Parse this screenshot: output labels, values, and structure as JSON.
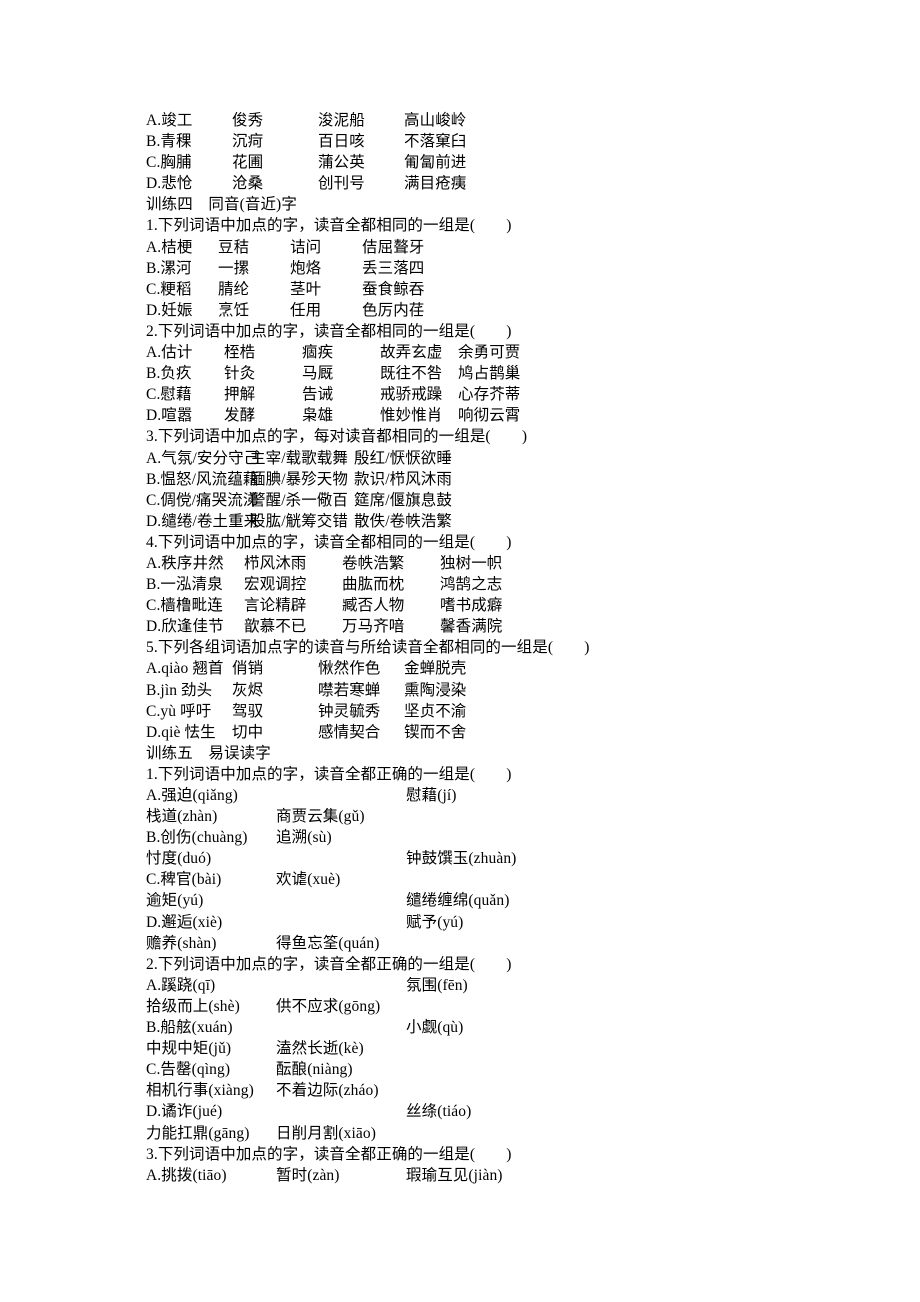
{
  "document": {
    "blocks": [
      {
        "kind": "option",
        "cols": "w-a",
        "lead": "A.竣工",
        "items": [
          "俊秀",
          "浚泥船",
          "高山峻岭"
        ]
      },
      {
        "kind": "option",
        "cols": "w-a",
        "lead": "B.青稞",
        "items": [
          "沉疴",
          "百日咳",
          "不落窠臼"
        ]
      },
      {
        "kind": "option",
        "cols": "w-a",
        "lead": "C.胸脯",
        "items": [
          "花圃",
          "蒲公英",
          "匍匐前进"
        ]
      },
      {
        "kind": "option",
        "cols": "w-a",
        "lead": "D.悲怆",
        "items": [
          "沧桑",
          "创刊号",
          "满目疮痍"
        ]
      },
      {
        "kind": "section",
        "text": "训练四　同音(音近)字"
      },
      {
        "kind": "question",
        "text": "1.下列词语中加点的字，读音全都相同的一组是(　　)"
      },
      {
        "kind": "option",
        "cols": "w-b",
        "lead": "A.桔梗",
        "items": [
          "豆秸",
          "诘问",
          "佶屈聱牙"
        ]
      },
      {
        "kind": "option",
        "cols": "w-b",
        "lead": "B.漯河",
        "items": [
          "一摞",
          "炮烙",
          "丢三落四"
        ]
      },
      {
        "kind": "option",
        "cols": "w-b",
        "lead": "C.粳稻",
        "items": [
          "腈纶",
          "茎叶",
          "蚕食鲸吞"
        ]
      },
      {
        "kind": "option",
        "cols": "w-b",
        "lead": "D.妊娠",
        "items": [
          "烹饪",
          "任用",
          "色厉内荏"
        ]
      },
      {
        "kind": "question",
        "text": "2.下列词语中加点的字，读音全都相同的一组是(　　)"
      },
      {
        "kind": "option",
        "cols": "w-c",
        "lead": "A.估计",
        "items": [
          "桎梏",
          "痼疾",
          "故弄玄虚",
          "余勇可贾"
        ]
      },
      {
        "kind": "option",
        "cols": "w-c",
        "lead": "B.负疚",
        "items": [
          "针灸",
          "马厩",
          "既往不咎",
          "鸠占鹊巢"
        ]
      },
      {
        "kind": "option",
        "cols": "w-c",
        "lead": "C.慰藉",
        "items": [
          "押解",
          "告诫",
          "戒骄戒躁",
          "心存芥蒂"
        ]
      },
      {
        "kind": "option",
        "cols": "w-c",
        "lead": "D.喧嚣",
        "items": [
          "发酵",
          "枭雄",
          "惟妙惟肖",
          "响彻云霄"
        ]
      },
      {
        "kind": "question",
        "text": "3.下列词语中加点的字，每对读音都相同的一组是(　　)"
      },
      {
        "kind": "option",
        "cols": "w-d",
        "lead": "A.气氛/安分守己",
        "items": [
          "主宰/载歌载舞",
          "殷红/恹恹欲睡"
        ]
      },
      {
        "kind": "option",
        "cols": "w-d",
        "lead": "B.愠怒/风流蕴藉",
        "items": [
          "腼腆/暴殄天物",
          "款识/栉风沐雨"
        ]
      },
      {
        "kind": "option",
        "cols": "w-d",
        "lead": "C.倜傥/痛哭流涕",
        "items": [
          "警醒/杀一儆百",
          "筵席/偃旗息鼓"
        ]
      },
      {
        "kind": "option",
        "cols": "w-d",
        "lead": "D.缱绻/卷土重来",
        "items": [
          "股肱/觥筹交错",
          "散佚/卷帙浩繁"
        ]
      },
      {
        "kind": "question",
        "text": "4.下列词语中加点的字，读音全都相同的一组是(　　)"
      },
      {
        "kind": "option",
        "cols": "w-e",
        "lead": "A.秩序井然",
        "items": [
          "栉风沐雨",
          "卷帙浩繁",
          "独树一帜"
        ]
      },
      {
        "kind": "option",
        "cols": "w-e",
        "lead": "B.一泓清泉",
        "items": [
          "宏观调控",
          "曲肱而枕",
          "鸿鹄之志"
        ]
      },
      {
        "kind": "option",
        "cols": "w-e",
        "lead": "C.樯橹毗连",
        "items": [
          "言论精辟",
          "臧否人物",
          "嗜书成癖"
        ]
      },
      {
        "kind": "option",
        "cols": "w-e",
        "lead": "D.欣逢佳节",
        "items": [
          "歆慕不已",
          "万马齐喑",
          "馨香满院"
        ]
      },
      {
        "kind": "question",
        "text": "5.下列各组词语加点字的读音与所给读音全都相同的一组是(　　)"
      },
      {
        "kind": "option",
        "cols": "w-f",
        "lead": "A.qiào 翘首",
        "items": [
          "俏销",
          "愀然作色",
          "金蝉脱壳"
        ]
      },
      {
        "kind": "option",
        "cols": "w-f",
        "lead": "B.jìn 劲头",
        "items": [
          "灰烬",
          "噤若寒蝉",
          "熏陶浸染"
        ]
      },
      {
        "kind": "option",
        "cols": "w-f",
        "lead": "C.yù 呼吁",
        "items": [
          "驾驭",
          "钟灵毓秀",
          "坚贞不渝"
        ]
      },
      {
        "kind": "option",
        "cols": "w-f",
        "lead": "D.qiè 怯生",
        "items": [
          "切中",
          "感情契合",
          "锲而不舍"
        ]
      },
      {
        "kind": "section",
        "text": "训练五　易误读字"
      },
      {
        "kind": "question",
        "text": "1.下列词语中加点的字，读音全都正确的一组是(　　)"
      },
      {
        "kind": "option",
        "cols": "w-g",
        "lead": "A.强迫(qiǎng)",
        "items": [
          "",
          "慰藉(jí)"
        ]
      },
      {
        "kind": "option",
        "cols": "w-g",
        "lead": "栈道(zhàn)",
        "items": [
          "商贾云集(gǔ)"
        ]
      },
      {
        "kind": "option",
        "cols": "w-g",
        "lead": "B.创伤(chuàng)",
        "items": [
          "追溯(sù)"
        ]
      },
      {
        "kind": "option",
        "cols": "w-g",
        "lead": "忖度(duó)",
        "items": [
          "",
          "钟鼓馔玉(zhuàn)"
        ]
      },
      {
        "kind": "option",
        "cols": "w-g",
        "lead": "C.稗官(bài)",
        "items": [
          "欢谑(xuè)"
        ]
      },
      {
        "kind": "option",
        "cols": "w-g",
        "lead": "逾矩(yú)",
        "items": [
          "",
          "缱绻缠绵(quǎn)"
        ]
      },
      {
        "kind": "option",
        "cols": "w-g",
        "lead": "D.邂逅(xiè)",
        "items": [
          "",
          "赋予(yú)"
        ]
      },
      {
        "kind": "option",
        "cols": "w-g",
        "lead": "赡养(shàn)",
        "items": [
          "得鱼忘筌(quán)"
        ]
      },
      {
        "kind": "question",
        "text": "2.下列词语中加点的字，读音全都正确的一组是(　　)"
      },
      {
        "kind": "option",
        "cols": "w-g",
        "lead": "A.蹊跷(qī)",
        "items": [
          "",
          "氛围(fēn)"
        ]
      },
      {
        "kind": "option",
        "cols": "w-g",
        "lead": "拾级而上(shè)",
        "items": [
          "供不应求(gōng)"
        ]
      },
      {
        "kind": "option",
        "cols": "w-g",
        "lead": "B.船舷(xuán)",
        "items": [
          "",
          "小觑(qù)"
        ]
      },
      {
        "kind": "option",
        "cols": "w-g",
        "lead": "中规中矩(jǔ)",
        "items": [
          "溘然长逝(kè)"
        ]
      },
      {
        "kind": "option",
        "cols": "w-g",
        "lead": "C.告罄(qìng)",
        "items": [
          "酝酿(niàng)"
        ]
      },
      {
        "kind": "option",
        "cols": "w-g",
        "lead": "相机行事(xiàng)",
        "items": [
          "不着边际(zháo)"
        ]
      },
      {
        "kind": "option",
        "cols": "w-g",
        "lead": "D.谲诈(jué)",
        "items": [
          "",
          "丝绦(tiáo)"
        ]
      },
      {
        "kind": "option",
        "cols": "w-g",
        "lead": "力能扛鼎(gāng)",
        "items": [
          "日削月割(xiāo)"
        ]
      },
      {
        "kind": "question",
        "text": "3.下列词语中加点的字，读音全都正确的一组是(　　)"
      },
      {
        "kind": "option",
        "cols": "w-g",
        "lead": "A.挑拨(tiāo)",
        "items": [
          "暂时(zàn)",
          "瑕瑜互见(jiàn)"
        ]
      }
    ]
  }
}
